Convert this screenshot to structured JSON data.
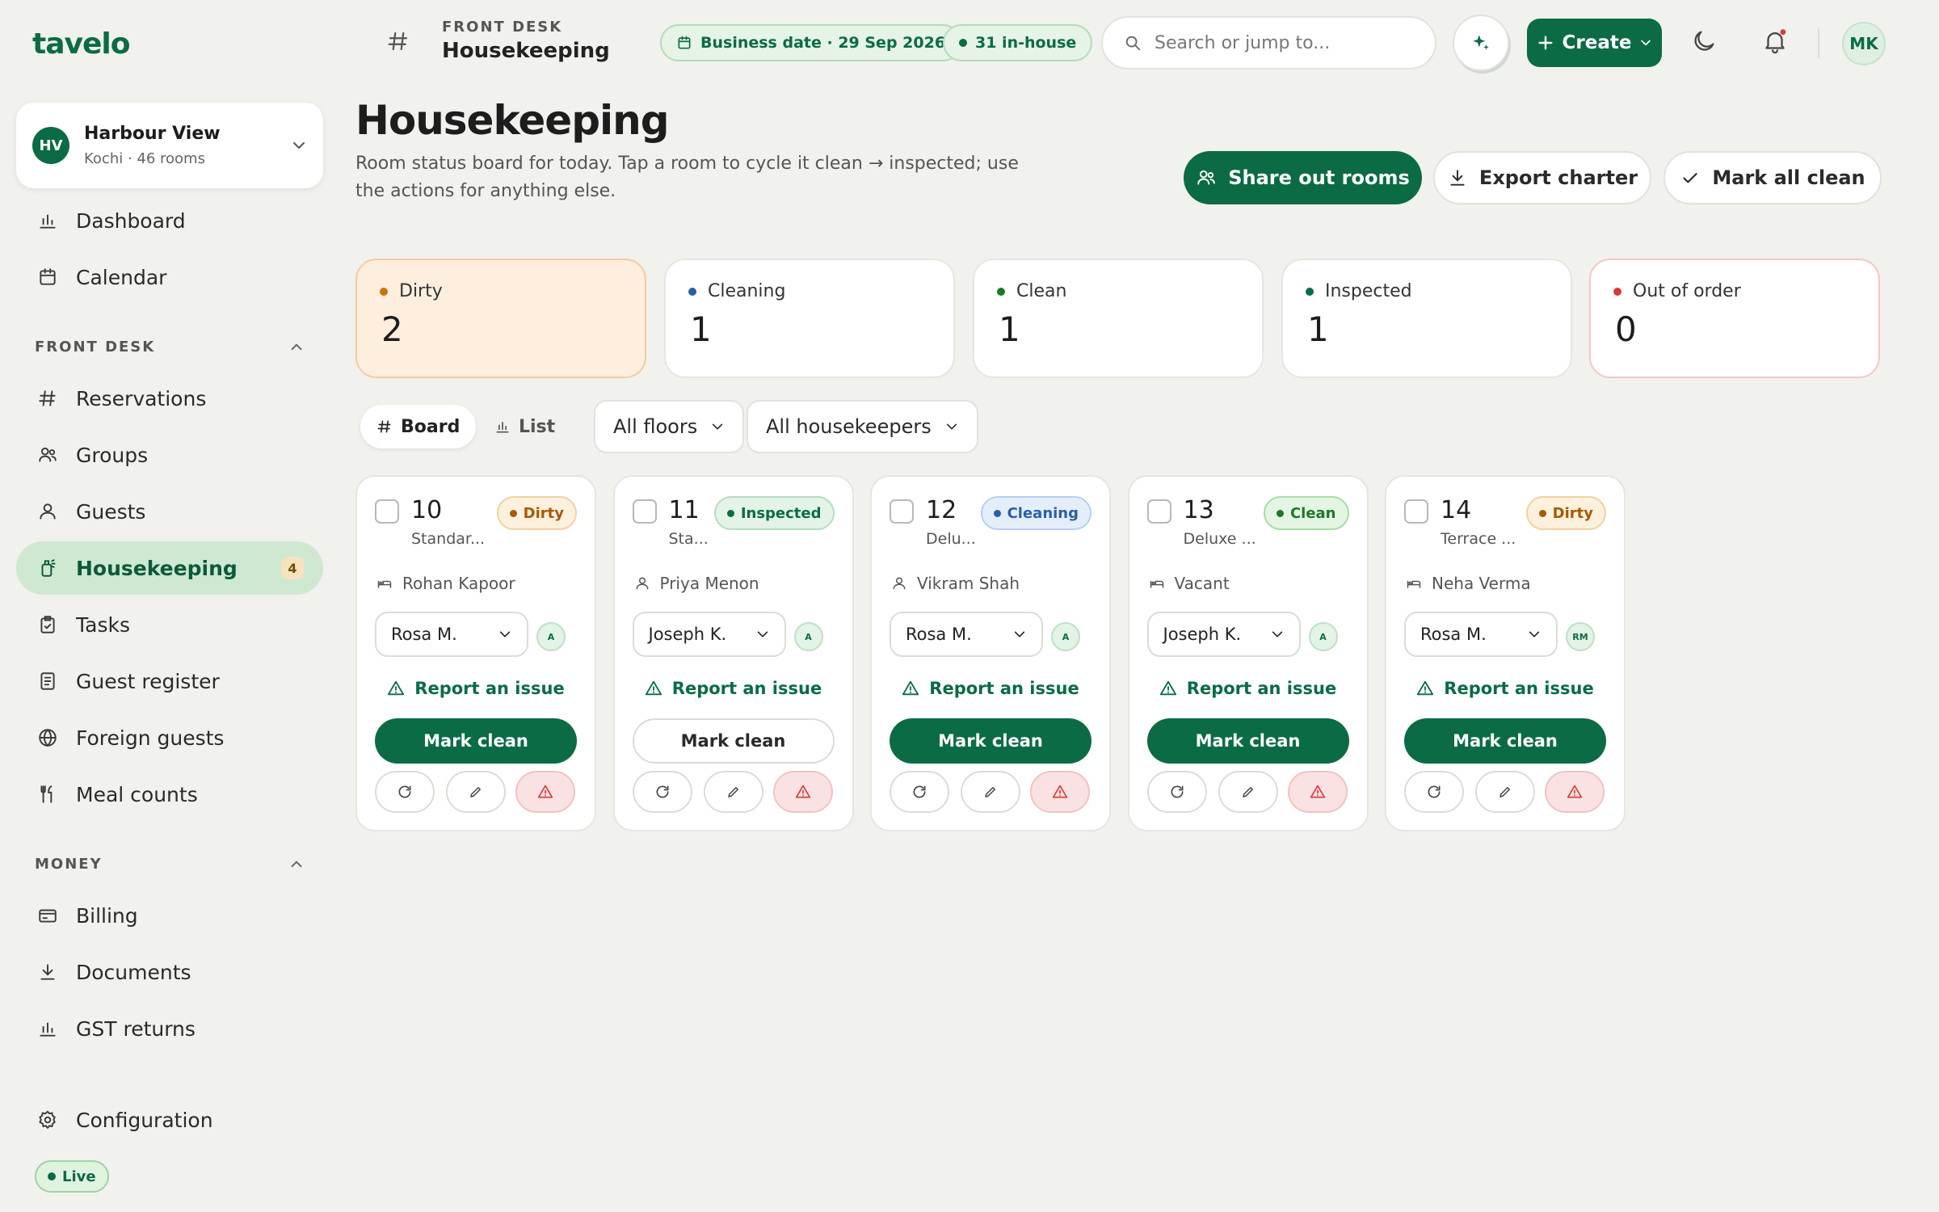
{
  "brand": "tavelo",
  "property": {
    "initials": "HV",
    "name": "Harbour View",
    "sub": "Kochi · 46 rooms"
  },
  "sidebar": {
    "top": [
      {
        "label": "Dashboard",
        "icon": "bar-chart-icon"
      },
      {
        "label": "Calendar",
        "icon": "calendar-icon"
      }
    ],
    "front_desk_label": "FRONT DESK",
    "front_desk": [
      {
        "label": "Reservations",
        "icon": "hash-icon"
      },
      {
        "label": "Groups",
        "icon": "users-icon"
      },
      {
        "label": "Guests",
        "icon": "user-icon"
      },
      {
        "label": "Housekeeping",
        "icon": "housekeeping-icon",
        "badge": "4",
        "active": true
      },
      {
        "label": "Tasks",
        "icon": "clipboard-icon"
      },
      {
        "label": "Guest register",
        "icon": "register-icon"
      },
      {
        "label": "Foreign guests",
        "icon": "globe-icon"
      },
      {
        "label": "Meal counts",
        "icon": "cutlery-icon"
      }
    ],
    "money_label": "MONEY",
    "money": [
      {
        "label": "Billing",
        "icon": "card-icon"
      },
      {
        "label": "Documents",
        "icon": "download-icon"
      },
      {
        "label": "GST returns",
        "icon": "bar-chart-icon"
      }
    ],
    "configuration": {
      "label": "Configuration",
      "icon": "gear-icon"
    },
    "live": "Live"
  },
  "topbar": {
    "crumb_label": "FRONT DESK",
    "crumb_title": "Housekeeping",
    "business_date": "Business date · 29 Sep 2026",
    "in_house": "31 in-house",
    "search_placeholder": "Search or jump to...",
    "create_label": "Create",
    "user_initials": "MK"
  },
  "page": {
    "title": "Housekeeping",
    "description": "Room status board for today. Tap a room to cycle it clean → inspected; use the actions for anything else.",
    "actions": {
      "share": "Share out rooms",
      "export": "Export charter",
      "mark_all": "Mark all clean"
    }
  },
  "stats": [
    {
      "label": "Dirty",
      "value": "2",
      "color": "#c8740c"
    },
    {
      "label": "Cleaning",
      "value": "1",
      "color": "#2b5fa6"
    },
    {
      "label": "Clean",
      "value": "1",
      "color": "#1c7a27"
    },
    {
      "label": "Inspected",
      "value": "1",
      "color": "#0b6b45"
    },
    {
      "label": "Out of order",
      "value": "0",
      "color": "#d53b3b"
    }
  ],
  "toolbar": {
    "board": "Board",
    "list": "List",
    "floors": "All floors",
    "housekeepers": "All housekeepers"
  },
  "rooms": [
    {
      "number": "10",
      "type": "Standar...",
      "status": "Dirty",
      "guest": "Rohan Kapoor",
      "guest_icon": "bed-icon",
      "assignee": "Rosa M.",
      "assignee_badge": "A",
      "action": "Mark clean",
      "action_style": "solid"
    },
    {
      "number": "11",
      "type": "Sta...",
      "status": "Inspected",
      "guest": "Priya Menon",
      "guest_icon": "user-icon",
      "assignee": "Joseph K.",
      "assignee_badge": "A",
      "action": "Mark clean",
      "action_style": "outline"
    },
    {
      "number": "12",
      "type": "Delu...",
      "status": "Cleaning",
      "guest": "Vikram Shah",
      "guest_icon": "user-icon",
      "assignee": "Rosa M.",
      "assignee_badge": "A",
      "action": "Mark clean",
      "action_style": "solid"
    },
    {
      "number": "13",
      "type": "Deluxe ...",
      "status": "Clean",
      "guest": "Vacant",
      "guest_icon": "bed-icon",
      "assignee": "Joseph K.",
      "assignee_badge": "A",
      "action": "Mark clean",
      "action_style": "solid"
    },
    {
      "number": "14",
      "type": "Terrace ...",
      "status": "Dirty",
      "guest": "Neha Verma",
      "guest_icon": "bed-icon",
      "assignee": "Rosa M.",
      "assignee_badge": "RM",
      "action": "Mark clean",
      "action_style": "solid"
    }
  ],
  "report_label": "Report an issue",
  "colors": {
    "brand": "#0b6b45",
    "active_nav": "#cfe8d2",
    "page_bg": "#f1f1ee",
    "danger": "#d53b3b"
  }
}
